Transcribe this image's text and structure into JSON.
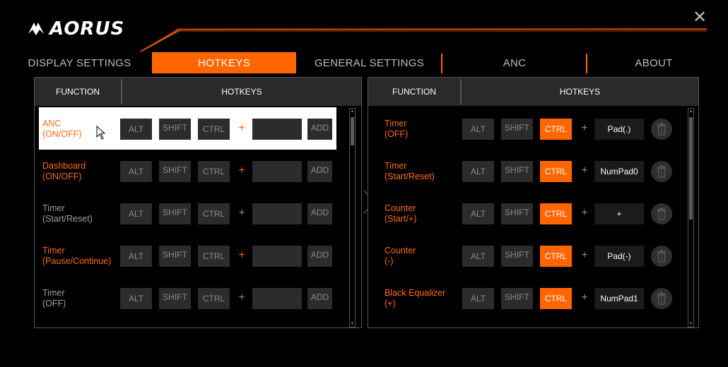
{
  "app": {
    "logo_text": "AORUS",
    "close_glyph": "✕"
  },
  "tabs": [
    {
      "label": "DISPLAY SETTINGS"
    },
    {
      "label": "HOTKEYS",
      "active": true
    },
    {
      "label": "GENERAL SETTINGS"
    },
    {
      "label": "ANC"
    },
    {
      "label": "ABOUT"
    }
  ],
  "left_panel": {
    "header_function": "FUNCTION",
    "header_hotkeys": "HOTKEYS",
    "rows": [
      {
        "l1": "ANC",
        "l2": "(ON/OFF)",
        "color": "orange",
        "alt": "ALT",
        "shift": "SHIFT",
        "ctrl": "CTRL",
        "plus": "+",
        "plus_color": "orange",
        "key": "",
        "add": "ADD",
        "selected": true
      },
      {
        "l1": "Dashboard",
        "l2": "(ON/OFF)",
        "color": "orange",
        "alt": "ALT",
        "shift": "SHIFT",
        "ctrl": "CTRL",
        "plus": "+",
        "plus_color": "orange",
        "key": "",
        "add": "ADD"
      },
      {
        "l1": "Timer",
        "l2": "(Start/Reset)",
        "color": "gray",
        "alt": "ALT",
        "shift": "SHIFT",
        "ctrl": "CTRL",
        "plus": "+",
        "plus_color": "gray",
        "key": "",
        "add": "ADD"
      },
      {
        "l1": "Timer",
        "l2": "(Pause/Continue)",
        "color": "orange",
        "alt": "ALT",
        "shift": "SHIFT",
        "ctrl": "CTRL",
        "plus": "+",
        "plus_color": "orange",
        "key": "",
        "add": "ADD"
      },
      {
        "l1": "Timer",
        "l2": "(OFF)",
        "color": "gray",
        "alt": "ALT",
        "shift": "SHIFT",
        "ctrl": "CTRL",
        "plus": "+",
        "plus_color": "gray",
        "key": "",
        "add": "ADD"
      }
    ]
  },
  "right_panel": {
    "header_function": "FUNCTION",
    "header_hotkeys": "HOTKEYS",
    "rows": [
      {
        "l1": "Timer",
        "l2": "(OFF)",
        "alt": "ALT",
        "shift": "SHIFT",
        "ctrl": "CTRL",
        "ctrl_on": true,
        "plus": "+",
        "key": "Pad(.)"
      },
      {
        "l1": "Timer",
        "l2": "(Start/Reset)",
        "alt": "ALT",
        "shift": "SHIFT",
        "ctrl": "CTRL",
        "ctrl_on": true,
        "plus": "+",
        "key": "NumPad0"
      },
      {
        "l1": "Counter",
        "l2": "(Start/+)",
        "alt": "ALT",
        "shift": "SHIFT",
        "ctrl": "CTRL",
        "ctrl_on": true,
        "plus": "+",
        "key": "+"
      },
      {
        "l1": "Counter",
        "l2": "(-)",
        "alt": "ALT",
        "shift": "SHIFT",
        "ctrl": "CTRL",
        "ctrl_on": true,
        "plus": "+",
        "key": "Pad(-)"
      },
      {
        "l1": "Black Equalizer",
        "l2": "(+)",
        "alt": "ALT",
        "shift": "SHIFT",
        "ctrl": "CTRL",
        "ctrl_on": true,
        "plus": "+",
        "key": "NumPad1"
      }
    ]
  },
  "colors": {
    "accent": "#ff6600",
    "label_orange": "#ff6a13",
    "label_gray": "#a0a0a0",
    "panel_border": "#555555"
  },
  "icons": [
    "aorus-eagle-icon",
    "close-icon",
    "trash-icon",
    "mouse-cursor-icon",
    "scroll-up-icon",
    "scroll-down-icon",
    "panel-divider-chevron-icon"
  ]
}
